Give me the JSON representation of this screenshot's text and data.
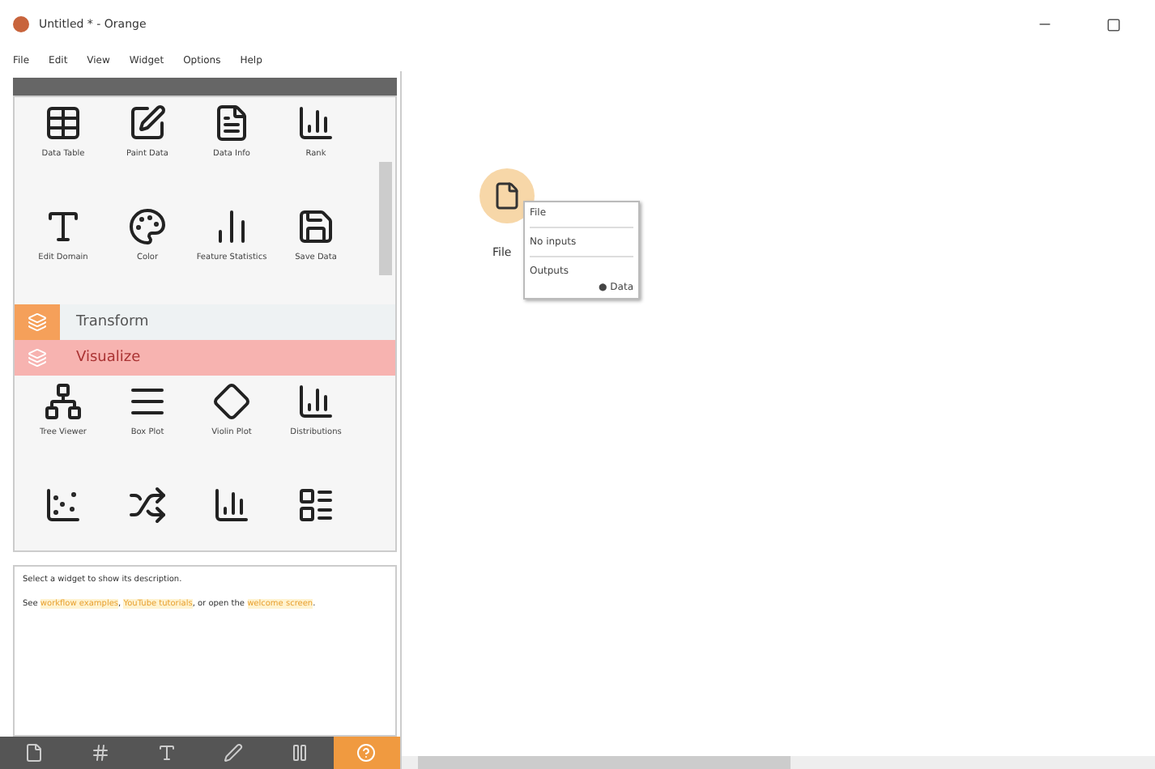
{
  "window": {
    "title": "Untitled * - Orange"
  },
  "menu": [
    "File",
    "Edit",
    "View",
    "Widget",
    "Options",
    "Help"
  ],
  "widgets_top": [
    {
      "label": "Data Table"
    },
    {
      "label": "Paint Data"
    },
    {
      "label": "Data Info"
    },
    {
      "label": "Rank"
    },
    {
      "label": "Edit Domain"
    },
    {
      "label": "Color"
    },
    {
      "label": "Feature Statistics"
    },
    {
      "label": "Save Data"
    }
  ],
  "categories": [
    {
      "label": "Transform",
      "selected": false,
      "color": "#f5a05a"
    },
    {
      "label": "Visualize",
      "selected": true,
      "color": "#f7b3b0"
    }
  ],
  "widgets_bottom": [
    {
      "label": "Tree Viewer"
    },
    {
      "label": "Box Plot"
    },
    {
      "label": "Violin Plot"
    },
    {
      "label": "Distributions"
    }
  ],
  "description": {
    "hint": "Select a widget to show its description.",
    "parts": [
      {
        "kind": "text",
        "text": "See"
      },
      {
        "kind": "link",
        "text": "workflow examples"
      },
      {
        "kind": "text",
        "text": ","
      },
      {
        "kind": "link",
        "text": "YouTube tutorials"
      },
      {
        "kind": "text",
        "text": ", or open the"
      },
      {
        "kind": "link",
        "text": "welcome screen"
      },
      {
        "kind": "text",
        "text": "."
      }
    ]
  },
  "toolbar": [
    {
      "selected": false
    },
    {
      "selected": false
    },
    {
      "selected": false
    },
    {
      "selected": false
    },
    {
      "selected": false
    },
    {
      "selected": true
    }
  ],
  "node": {
    "label": "File",
    "tooltip": {
      "title": "File",
      "inputs": "No inputs",
      "outputs_title": "Outputs",
      "outputs": [
        "● Data"
      ]
    }
  }
}
